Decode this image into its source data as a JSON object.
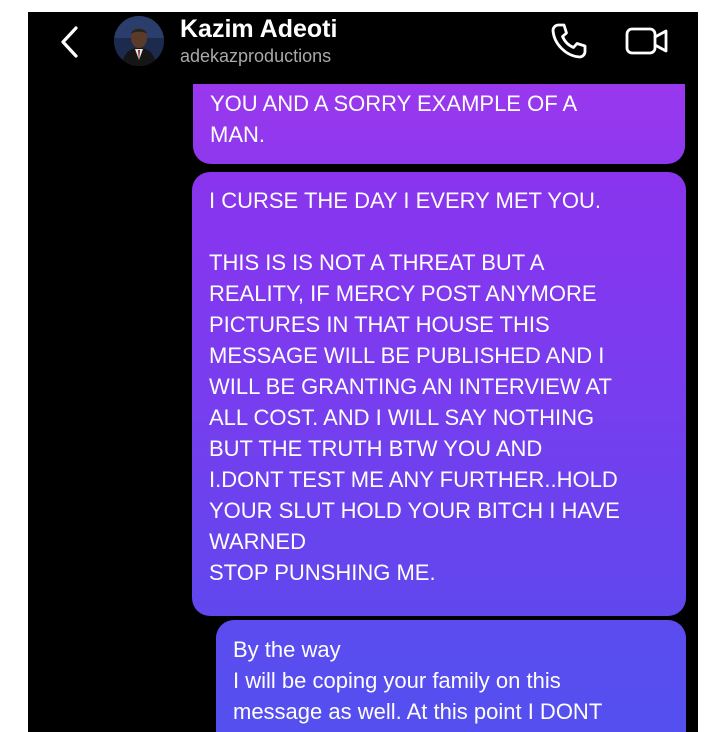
{
  "contact": {
    "name": "Kazim Adeoti",
    "username": "adekazproductions"
  },
  "icons": {
    "back": "chevron-left-icon",
    "call": "phone-icon",
    "video": "video-camera-icon"
  },
  "colors": {
    "background": "#000000",
    "bubble_purple": "#9a38ee",
    "bubble_violet": "#7a3cef",
    "bubble_indigo": "#5350ef"
  },
  "messages": [
    {
      "text": "YOU AND A SORRY EXAMPLE OF A\nMAN."
    },
    {
      "text": "I CURSE THE DAY I EVERY MET YOU.\n\nTHIS IS IS NOT A THREAT BUT A\nREALITY, IF MERCY POST ANYMORE\nPICTURES IN THAT HOUSE THIS\nMESSAGE WILL BE PUBLISHED AND I\nWILL BE GRANTING AN INTERVIEW AT\nALL COST. AND I WILL SAY NOTHING\nBUT THE TRUTH BTW YOU AND\nI.DONT TEST ME ANY FURTHER..HOLD\nYOUR SLUT HOLD YOUR BITCH I HAVE\nWARNED\nSTOP PUNSHING ME."
    },
    {
      "text": "By the way\nI will be  coping your family on this\nmessage as well. At this point I DONT"
    }
  ]
}
